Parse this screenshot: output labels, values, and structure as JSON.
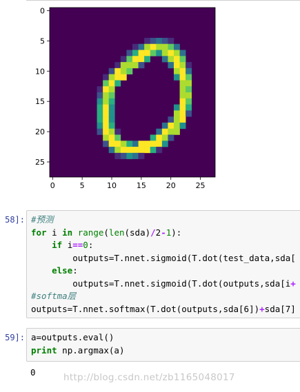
{
  "plot": {
    "image_rows": [
      "0000000000000000000000000000",
      "0000000000000000000000000000",
      "0000000000000000000000000000",
      "0000000000000000000000000000",
      "0000000000000000000000000000",
      "0000000000000000123210000000",
      "0000000000000013787763000000",
      "0000000000000258864787300000",
      "0000000000001688500378600000",
      "0000000000017772000038710000",
      "0000000000287600000007830000",
      "0000000001788000000004860000",
      "0000000006850000000000770000",
      "0000000018700000000000760000",
      "0000000027600000000000770000",
      "0000000047500000000000860000",
      "0000000058400000000004850000",
      "0000000058400000000007820000",
      "0000000058400000000027800000",
      "0000000048500000000387400000",
      "0000000028710000003877000000",
      "0000000007860000058720000000",
      "0000000002887538888400000000",
      "0000000000378888851000000000",
      "0000000000012431000000000000",
      "0000000000000000000000000000",
      "0000000000000000000000000000",
      "0000000000000000000000000000"
    ],
    "palette": [
      "#440154",
      "#472c7a",
      "#3b528b",
      "#2c728e",
      "#21918c",
      "#28ae80",
      "#5ec962",
      "#addc30",
      "#fde725"
    ],
    "x_ticks": [
      "0",
      "5",
      "10",
      "15",
      "20",
      "25"
    ],
    "y_ticks": [
      "0",
      "5",
      "10",
      "15",
      "20",
      "25"
    ]
  },
  "cells": [
    {
      "prompt": "58]:",
      "lines": [
        [
          {
            "t": "#预测",
            "c": "cm"
          }
        ],
        [
          {
            "t": "for",
            "c": "kw"
          },
          {
            "t": " i "
          },
          {
            "t": "in",
            "c": "kw"
          },
          {
            "t": " "
          },
          {
            "t": "range",
            "c": "bi"
          },
          {
            "t": "("
          },
          {
            "t": "len",
            "c": "bi"
          },
          {
            "t": "(sda)"
          },
          {
            "t": "/",
            "c": "op"
          },
          {
            "t": "2"
          },
          {
            "t": "-",
            "c": "op"
          },
          {
            "t": "1",
            "c": "nm"
          },
          {
            "t": "):"
          }
        ],
        [
          {
            "t": "    "
          },
          {
            "t": "if",
            "c": "kw"
          },
          {
            "t": " i"
          },
          {
            "t": "==",
            "c": "op"
          },
          {
            "t": "0",
            "c": "nm"
          },
          {
            "t": ":"
          }
        ],
        [
          {
            "t": "        outputs=T.nnet.sigmoid(T.dot(test_data,sda["
          }
        ],
        [
          {
            "t": "    "
          },
          {
            "t": "else",
            "c": "kw"
          },
          {
            "t": ":"
          }
        ],
        [
          {
            "t": "        outputs=T.nnet.sigmoid(T.dot(outputs,sda[i"
          },
          {
            "t": "+",
            "c": "op"
          }
        ],
        [
          {
            "t": "#softma层",
            "c": "cm"
          }
        ],
        [
          {
            "t": "outputs=T.nnet.softmax(T.dot(outputs,sda[6])"
          },
          {
            "t": "+",
            "c": "op"
          },
          {
            "t": "sda[7]"
          }
        ]
      ]
    },
    {
      "prompt": "59]:",
      "lines": [
        [
          {
            "t": "a=outputs.eval()"
          }
        ],
        [
          {
            "t": "print",
            "c": "kw"
          },
          {
            "t": " np.argmax(a)"
          }
        ]
      ]
    }
  ],
  "output": {
    "text": "0"
  },
  "watermark": {
    "text": "http://blog.csdn.net/zb1165048017"
  }
}
